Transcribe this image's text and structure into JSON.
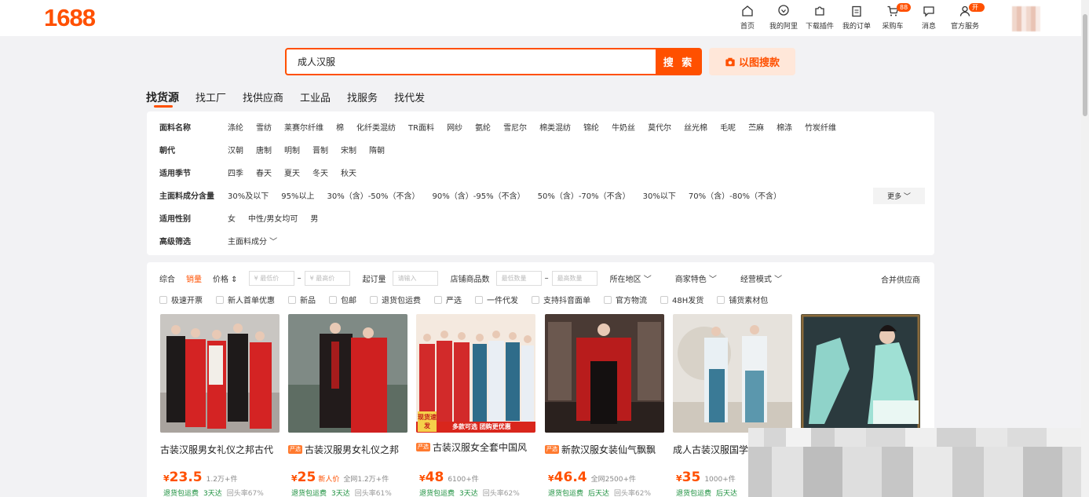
{
  "brand": {
    "logo": "1688",
    "accent": "#ff5000"
  },
  "nav": [
    {
      "label": "首页",
      "icon": "home-icon"
    },
    {
      "label": "我的阿里",
      "icon": "user-heart-icon"
    },
    {
      "label": "下载插件",
      "icon": "puzzle-icon"
    },
    {
      "label": "我的订单",
      "icon": "clipboard-icon"
    },
    {
      "label": "采购车",
      "icon": "cart-icon",
      "badge": "88"
    },
    {
      "label": "消息",
      "icon": "message-icon"
    },
    {
      "label": "官方服务",
      "icon": "service-icon",
      "badge": "开店"
    }
  ],
  "search": {
    "value": "成人汉服",
    "button": "搜 索",
    "image_search": "以图搜款"
  },
  "tabs": [
    "找货源",
    "找工厂",
    "找供应商",
    "工业品",
    "找服务",
    "找代发"
  ],
  "filters": [
    {
      "name": "面料名称",
      "options": [
        "涤纶",
        "雪纺",
        "莱赛尔纤维",
        "棉",
        "化纤类混纺",
        "TR面料",
        "网纱",
        "氨纶",
        "雪尼尔",
        "棉类混纺",
        "锦纶",
        "牛奶丝",
        "莫代尔",
        "丝光棉",
        "毛呢",
        "苎麻",
        "棉涤",
        "竹炭纤维"
      ]
    },
    {
      "name": "朝代",
      "options": [
        "汉朝",
        "唐制",
        "明制",
        "晋制",
        "宋制",
        "隋朝"
      ]
    },
    {
      "name": "适用季节",
      "options": [
        "四季",
        "春天",
        "夏天",
        "冬天",
        "秋天"
      ]
    },
    {
      "name": "主面料成分含量",
      "options": [
        "30%及以下",
        "95%以上",
        "30%（含）-50%（不含）",
        "90%（含）-95%（不含）",
        "50%（含）-70%（不含）",
        "30%以下",
        "70%（含）-80%（不含）"
      ]
    },
    {
      "name": "适用性别",
      "options": [
        "女",
        "中性/男女均可",
        "男"
      ]
    },
    {
      "name": "高级筛选",
      "options": [
        "主面料成分 ﹀"
      ]
    }
  ],
  "more": "更多 ﹀",
  "sort": {
    "items": [
      "综合",
      "销量",
      "价格 ⇕"
    ],
    "price_min": "¥ 最低价",
    "price_max": "¥ 最高价",
    "moq_label": "起订量",
    "moq_placeholder": "请输入",
    "shop_count_label": "店铺商品数",
    "shop_min": "最低数量",
    "shop_max": "最高数量",
    "region": "所在地区 ﹀",
    "merchant": "商家特色 ﹀",
    "business": "经营模式 ﹀",
    "merge": "合并供应商",
    "dash": "–"
  },
  "checks": [
    "极速开票",
    "新人首单优惠",
    "新品",
    "包邮",
    "退货包运费",
    "严选",
    "一件代发",
    "支持抖音面单",
    "官方物流",
    "48H发货",
    "铺货素材包"
  ],
  "products": [
    {
      "title": "古装汉服男女礼仪之邦古代",
      "tag": "",
      "cur": "¥",
      "price": "23.5",
      "extra": "",
      "sold": "1.2万+件",
      "ship": "退货包运费",
      "days": "3天达",
      "repurchase": "回头率67%"
    },
    {
      "title": "古装汉服男女礼仪之邦",
      "tag": "严选",
      "cur": "¥",
      "price": "25",
      "extra": "新人价",
      "sold": "全网1.2万+件",
      "ship": "退货包运费",
      "days": "3天达",
      "repurchase": "回头率61%"
    },
    {
      "title": "古装汉服女全套中国风",
      "tag": "严选",
      "cur": "¥",
      "price": "48",
      "extra": "",
      "sold": "6100+件",
      "ship": "退货包运费",
      "days": "3天达",
      "repurchase": "回头率62%",
      "banner1": "现货速发",
      "banner2": "多款可选 团购更优惠"
    },
    {
      "title": "新款汉服女装仙气飘飘",
      "tag": "严选",
      "cur": "¥",
      "price": "46.4",
      "extra": "",
      "sold": "全网2500+件",
      "ship": "退货包运费",
      "days": "后天达",
      "repurchase": "回头率62%"
    },
    {
      "title": "成人古装汉服国学",
      "tag": "",
      "cur": "¥",
      "price": "35",
      "extra": "",
      "sold": "1000+件",
      "ship": "退货包运费",
      "days": "后天达",
      "repurchase": ""
    },
    {
      "title": "",
      "tag": "",
      "cur": "",
      "price": "",
      "extra": "",
      "sold": "",
      "ship": "",
      "days": "",
      "repurchase": ""
    }
  ]
}
